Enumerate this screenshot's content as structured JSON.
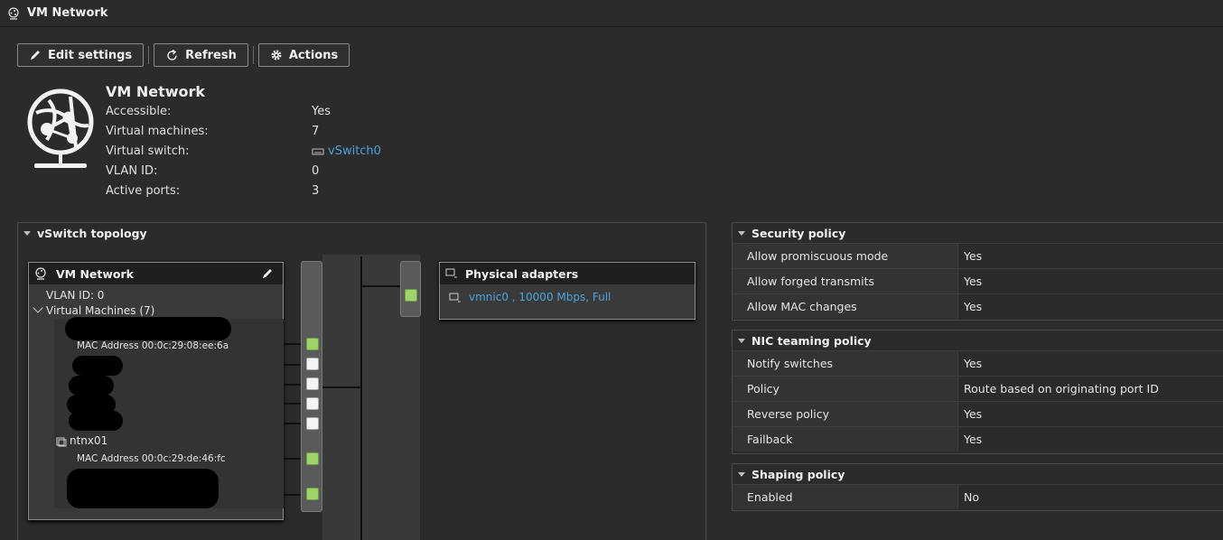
{
  "window": {
    "title": "VM Network"
  },
  "toolbar": {
    "edit_label": "Edit settings",
    "refresh_label": "Refresh",
    "actions_label": "Actions"
  },
  "summary": {
    "title": "VM Network",
    "rows": [
      {
        "label": "Accessible:",
        "value": "Yes"
      },
      {
        "label": "Virtual machines:",
        "value": "7"
      },
      {
        "label": "Virtual switch:",
        "value": "vSwitch0"
      },
      {
        "label": "VLAN ID:",
        "value": "0"
      },
      {
        "label": "Active ports:",
        "value": "3"
      }
    ]
  },
  "topology": {
    "title": "vSwitch topology",
    "portgroup": {
      "name": "VM Network",
      "vlan": "VLAN ID: 0",
      "vms_label": "Virtual Machines (7)",
      "vm1_mac": "MAC Address 00:0c:29:08:ee:6a",
      "vm_ntnx": "ntnx01",
      "vm_ntnx_mac": "MAC Address 00:0c:29:de:46:fc"
    },
    "physical": {
      "title": "Physical adapters",
      "adapter": "vmnic0 , 10000 Mbps, Full"
    }
  },
  "security": {
    "title": "Security policy",
    "rows": [
      {
        "label": "Allow promiscuous mode",
        "value": "Yes"
      },
      {
        "label": "Allow forged transmits",
        "value": "Yes"
      },
      {
        "label": "Allow MAC changes",
        "value": "Yes"
      }
    ]
  },
  "teaming": {
    "title": "NIC teaming policy",
    "rows": [
      {
        "label": "Notify switches",
        "value": "Yes"
      },
      {
        "label": "Policy",
        "value": "Route based on originating port ID"
      },
      {
        "label": "Reverse policy",
        "value": "Yes"
      },
      {
        "label": "Failback",
        "value": "Yes"
      }
    ]
  },
  "shaping": {
    "title": "Shaping policy",
    "rows": [
      {
        "label": "Enabled",
        "value": "No"
      }
    ]
  },
  "colors": {
    "link": "#4aa3df",
    "port_up": "#9ed46a",
    "background": "#2b2b2b"
  }
}
